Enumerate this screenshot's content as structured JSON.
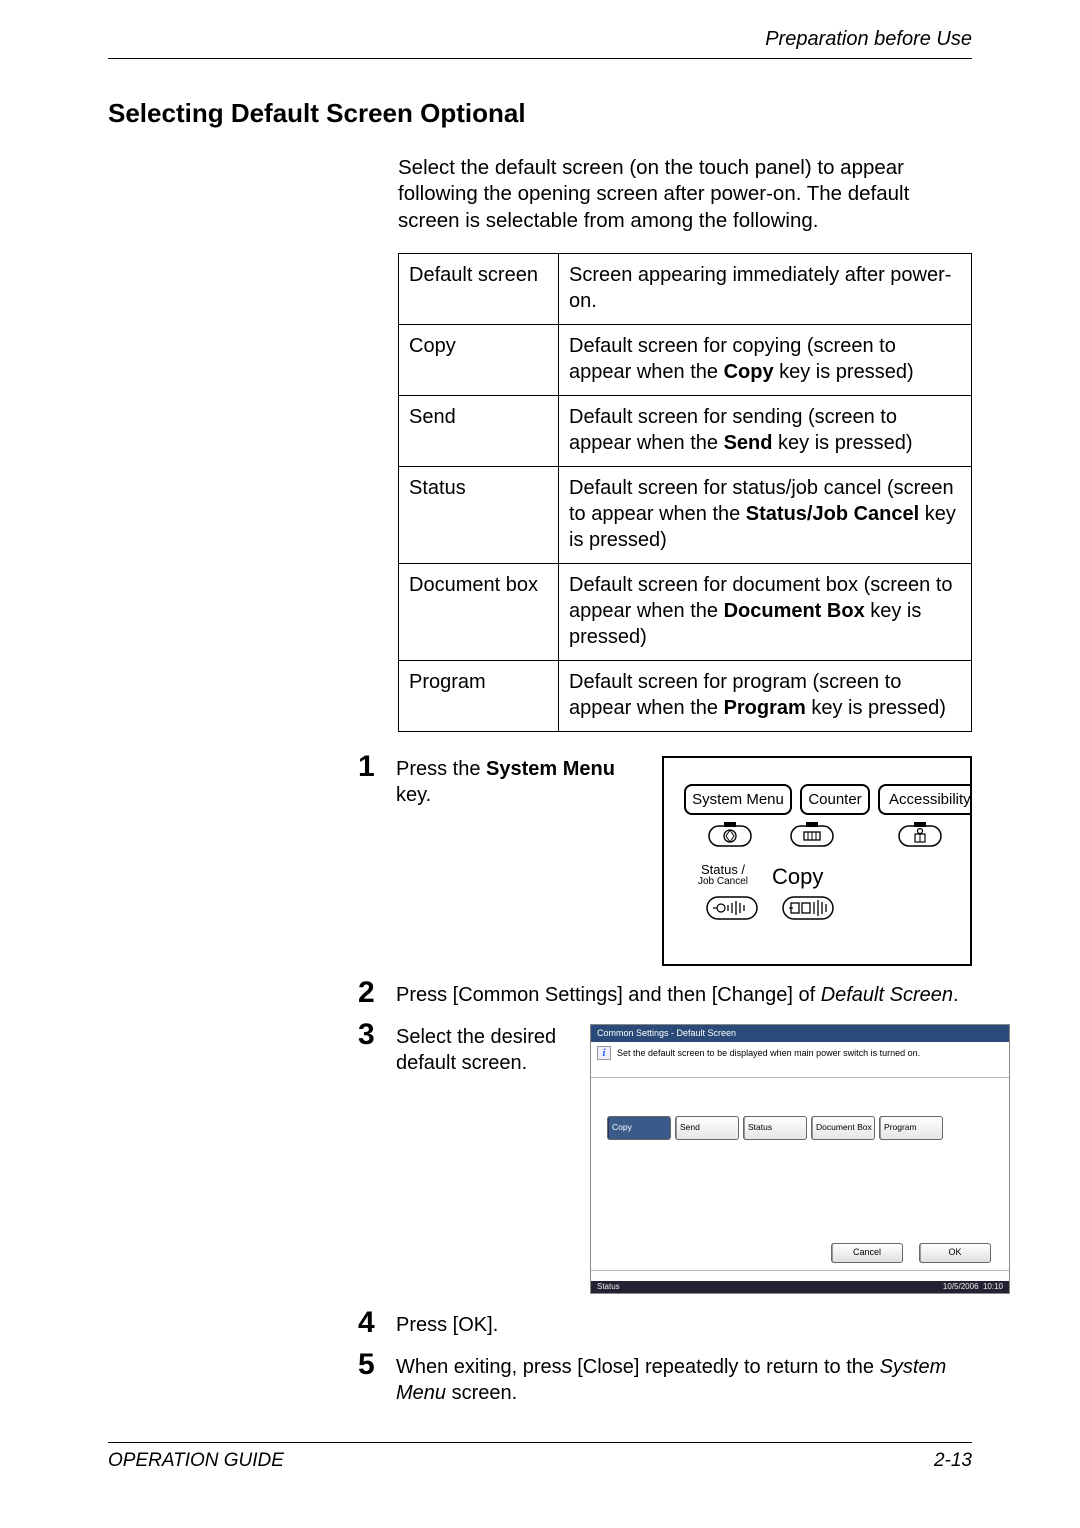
{
  "header": {
    "chapter": "Preparation before Use"
  },
  "title": "Selecting Default Screen Optional",
  "intro": "Select the default screen (on the touch panel) to appear following the opening screen after power-on. The default screen is selectable from among the following.",
  "table_rows": [
    {
      "left": "Default screen",
      "right_pre": "Screen appearing immediately after power-on.",
      "right_bold": "",
      "right_post": ""
    },
    {
      "left": "Copy",
      "right_pre": "Default screen for copying (screen to appear when the ",
      "right_bold": "Copy",
      "right_post": " key is pressed)"
    },
    {
      "left": "Send",
      "right_pre": "Default screen for sending (screen to appear when the ",
      "right_bold": "Send",
      "right_post": " key is pressed)"
    },
    {
      "left": "Status",
      "right_pre": "Default screen for status/job cancel (screen to appear when the ",
      "right_bold": "Status/Job Cancel",
      "right_post": " key is pressed)"
    },
    {
      "left": "Document box",
      "right_pre": "Default screen for document box (screen to appear when the ",
      "right_bold": "Document Box",
      "right_post": " key is pressed)"
    },
    {
      "left": "Program",
      "right_pre": "Default screen for program (screen to appear when the ",
      "right_bold": "Program",
      "right_post": " key is pressed)"
    }
  ],
  "steps": {
    "s1_pre": "Press the ",
    "s1_bold": "System Menu",
    "s1_post": " key.",
    "s2_pre": "Press [Common Settings] and then [Change] of ",
    "s2_italic": "Default Screen",
    "s2_post": ".",
    "s3": "Select the desired default screen.",
    "s4": "Press [OK].",
    "s5_pre": "When exiting, press [Close] repeatedly to return to the ",
    "s5_italic": "System Menu",
    "s5_post": " screen."
  },
  "panel1": {
    "system_menu": "System Menu",
    "counter": "Counter",
    "accessibility": "Accessibility Di",
    "status_line1": "Status /",
    "status_line2": "Job Cancel",
    "copy": "Copy"
  },
  "screenshot": {
    "title": "Common Settings - Default Screen",
    "instruction": "Set the default screen to be displayed when main power switch is turned on.",
    "buttons": [
      "Copy",
      "Send",
      "Status",
      "Document Box",
      "Program"
    ],
    "selected_index": 0,
    "cancel": "Cancel",
    "ok": "OK",
    "status_left": "Status",
    "status_date": "10/5/2006",
    "status_time": "10:10"
  },
  "footer": {
    "left": "OPERATION GUIDE",
    "right": "2-13"
  }
}
